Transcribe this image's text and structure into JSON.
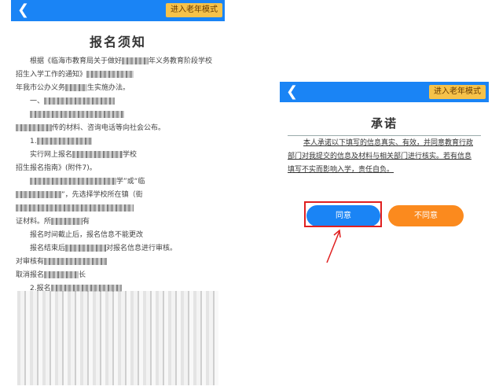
{
  "left_screen": {
    "back_icon": "chevron-left-icon",
    "elder_mode_label": "进入老年模式",
    "title": "报名须知",
    "lines": [
      {
        "pre": "根据《临海市教育局关于做好",
        "post": "年义务教育阶段学校",
        "indent": true
      },
      {
        "pre": "招生入学工作的通知》",
        "post": "",
        "indent": false
      },
      {
        "pre": "年我市公办义务",
        "post": "生实施办法。",
        "indent": false
      },
      {
        "pre": "一、",
        "post": "",
        "indent": true
      },
      {
        "pre": "",
        "post": "",
        "indent": true
      },
      {
        "pre": "",
        "post": "传的材料、咨询电话等向社会公布。",
        "indent": false
      },
      {
        "pre": "1.",
        "post": "",
        "indent": true
      },
      {
        "pre": "实行网上报名",
        "post": "学校",
        "indent": true
      },
      {
        "pre": "招生报名指南》(附件7)。",
        "post": "",
        "indent": false
      },
      {
        "pre": "",
        "post": "学”或“临",
        "indent": true
      },
      {
        "pre": "",
        "post": "”，先选择学校所在镇（街",
        "indent": false
      },
      {
        "pre": "",
        "post": "",
        "indent": false
      },
      {
        "pre": "证材料。所",
        "post": "有",
        "indent": false
      },
      {
        "pre": "报名时间截止后，报名信息不能更改",
        "post": "",
        "indent": true
      },
      {
        "pre": "报名结束后",
        "post": "对报名信息进行审核。",
        "indent": true
      },
      {
        "pre": "对审核有",
        "post": "",
        "indent": false
      },
      {
        "pre": "取消报名",
        "post": "长",
        "indent": false
      },
      {
        "pre": "2.报名",
        "post": "",
        "indent": true
      }
    ]
  },
  "right_screen": {
    "back_icon": "chevron-left-icon",
    "elder_mode_label": "进入老年模式",
    "title": "承诺",
    "promise_text": "本人承诺以下填写的信息真实、有效，并同意教育行政部门对我提交的信息及材料与相关部门进行核实。若有信息填写不实而影响入学，责任自负。",
    "agree_label": "同意",
    "disagree_label": "不同意"
  },
  "colors": {
    "topbar": "#1a84f5",
    "elder_button": "#f6c24a",
    "agree_button": "#1a84f5",
    "disagree_button": "#fb8a1e",
    "highlight": "#e02020"
  }
}
